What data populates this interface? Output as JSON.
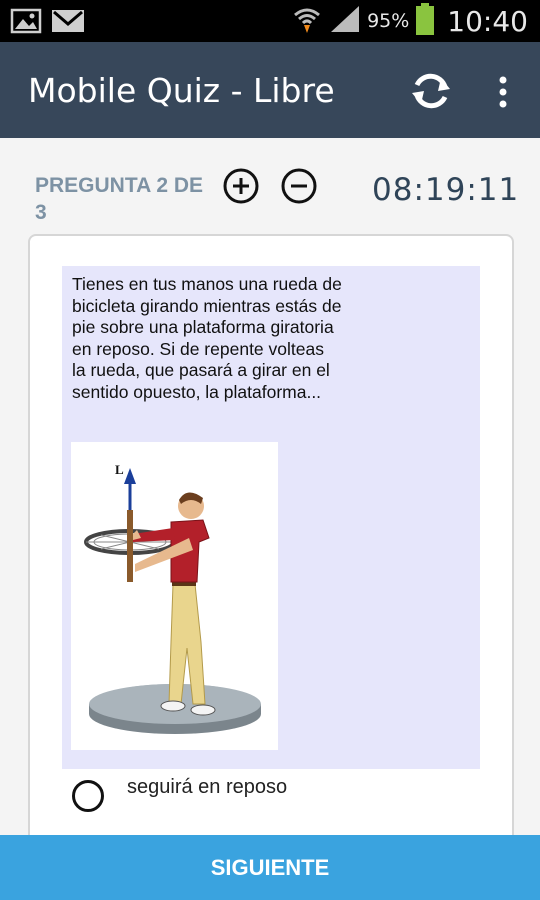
{
  "status_bar": {
    "battery_percent": "95%",
    "time": "10:40",
    "icons": [
      "image-icon",
      "gmail-icon",
      "wifi-icon",
      "signal-icon",
      "battery-icon"
    ]
  },
  "app_bar": {
    "title": "Mobile Quiz - Libre",
    "refresh_icon": "refresh-icon",
    "menu_icon": "overflow-menu-icon"
  },
  "quiz": {
    "counter": "PREGUNTA 2 DE 3",
    "timer": "08:19:11",
    "zoom_in_icon": "plus-circle-icon",
    "zoom_out_icon": "minus-circle-icon",
    "question": "Tienes en tus manos una rueda de bicicleta girando mientras estás de pie sobre una plataforma giratoria en reposo. Si de repente volteas la rueda, que pasará a girar en el sentido opuesto, la plataforma...",
    "figure_label": "L",
    "options": [
      {
        "label": "seguirá en reposo",
        "selected": false
      }
    ]
  },
  "footer": {
    "next_label": "SIGUIENTE"
  },
  "colors": {
    "app_bar": "#37475a",
    "accent": "#3aa3df",
    "question_bg": "#e6e6fb",
    "counter_text": "#7d92a4"
  }
}
